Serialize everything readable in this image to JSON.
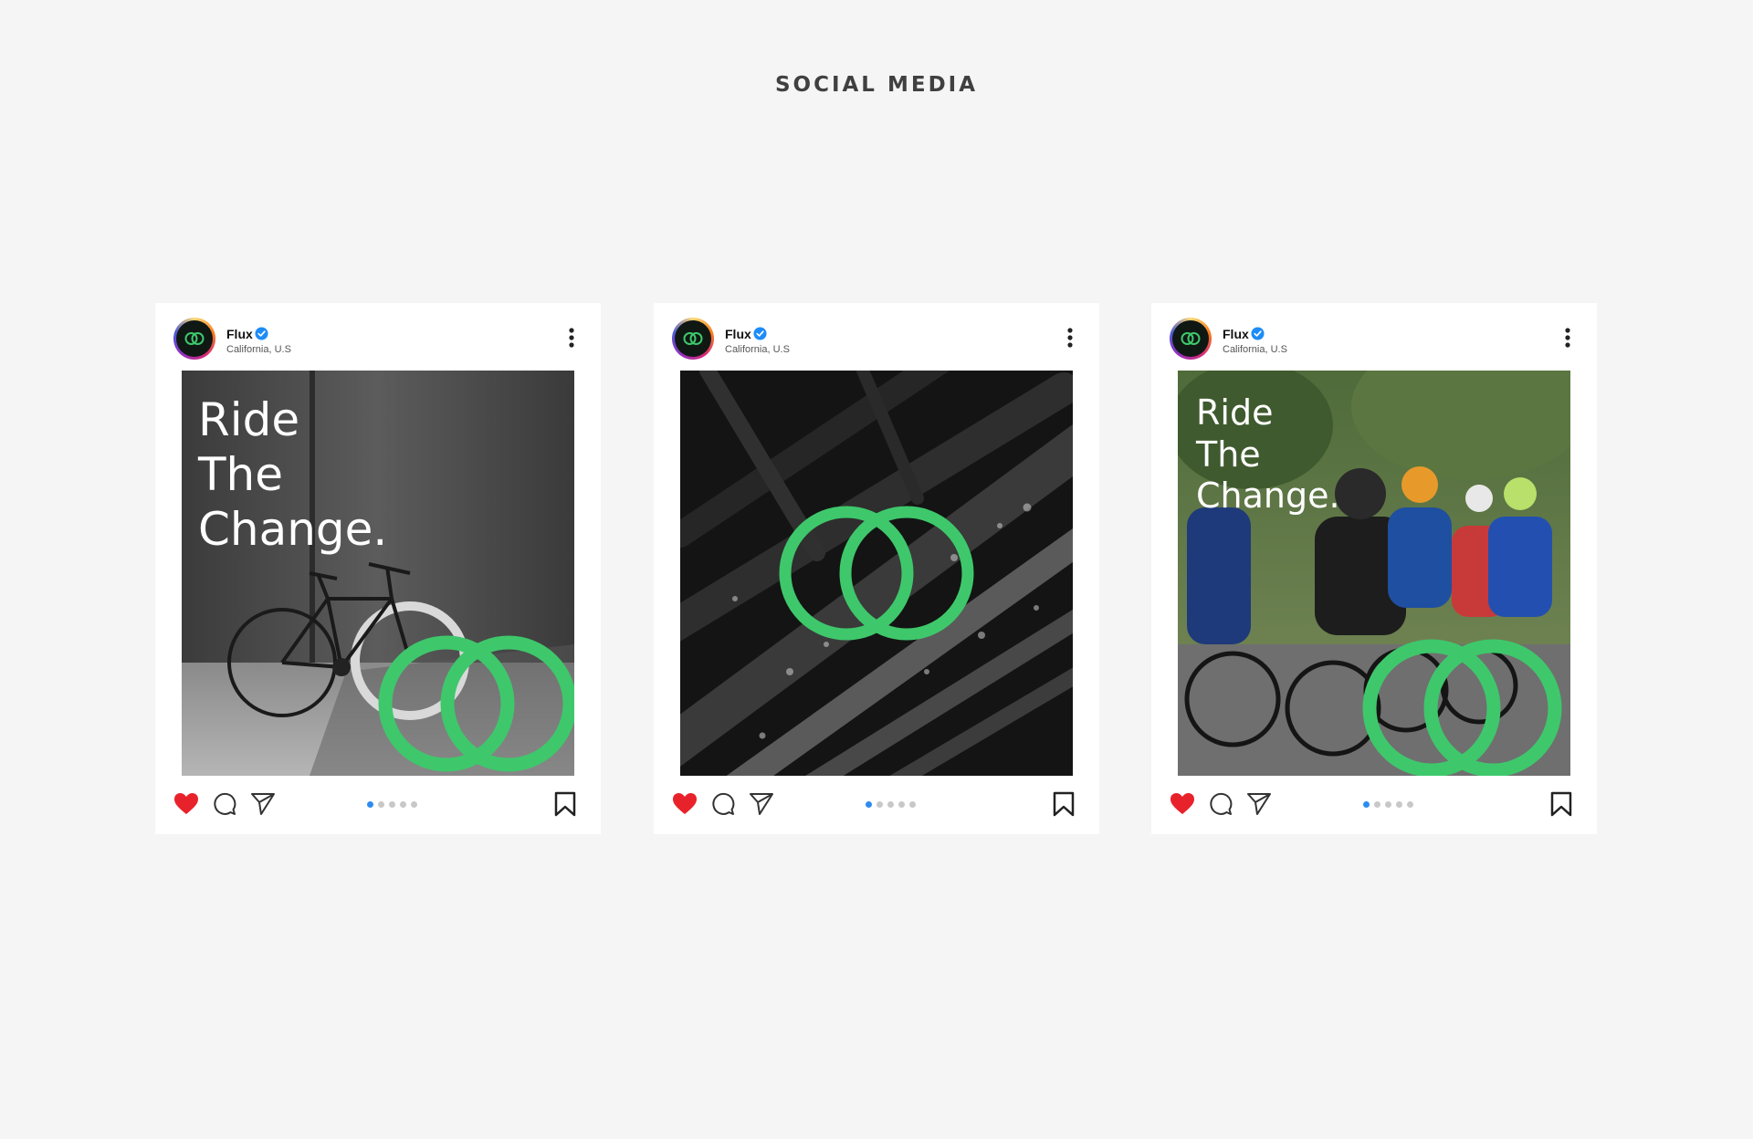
{
  "page": {
    "section_title": "SOCIAL MEDIA"
  },
  "colors": {
    "brand_green": "#3ec86b",
    "like_red": "#e8222b",
    "verified_blue": "#1d8cf8",
    "page_bg": "#f5f5f5",
    "active_dot": "#2d8cf0"
  },
  "icons": {
    "like": "heart-icon",
    "comment": "comment-icon",
    "share": "send-icon",
    "save": "bookmark-icon",
    "more": "more-vertical-icon",
    "verified": "verified-badge-icon"
  },
  "posts": [
    {
      "username": "Flux",
      "location": "California, U.S",
      "headline": "Ride\nThe\nChange.",
      "carousel_count": 5,
      "carousel_active": 1,
      "liked": true,
      "photo_subject": "bike against wall"
    },
    {
      "username": "Flux",
      "location": "California, U.S",
      "headline": "",
      "carousel_count": 5,
      "carousel_active": 1,
      "liked": true,
      "photo_subject": "dewy grass"
    },
    {
      "username": "Flux",
      "location": "California, U.S",
      "headline": "Ride\nThe\nChange.",
      "carousel_count": 5,
      "carousel_active": 1,
      "liked": true,
      "photo_subject": "cycling race"
    }
  ]
}
